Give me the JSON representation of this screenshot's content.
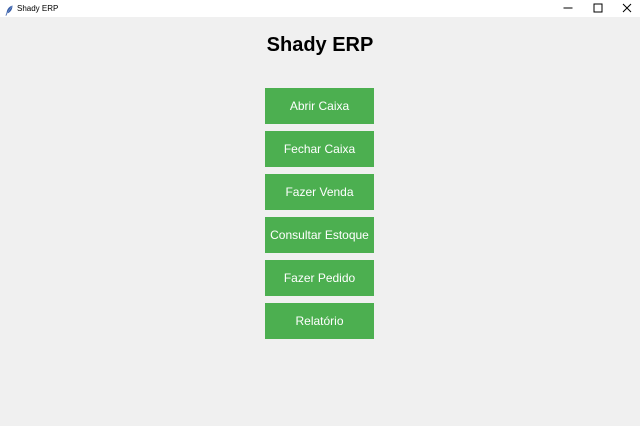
{
  "window": {
    "title": "Shady ERP",
    "icon": "feather-icon",
    "controls": [
      "minimize-icon",
      "maximize-icon",
      "close-icon"
    ]
  },
  "main": {
    "heading": "Shady ERP",
    "buttons": [
      {
        "label": "Abrir Caixa"
      },
      {
        "label": "Fechar Caixa"
      },
      {
        "label": "Fazer Venda"
      },
      {
        "label": "Consultar Estoque"
      },
      {
        "label": "Fazer Pedido"
      },
      {
        "label": "Relatório"
      }
    ]
  },
  "colors": {
    "background": "#f0f0f0",
    "button": "#4caf50",
    "button_text": "#ffffff",
    "titlebar": "#ffffff"
  }
}
